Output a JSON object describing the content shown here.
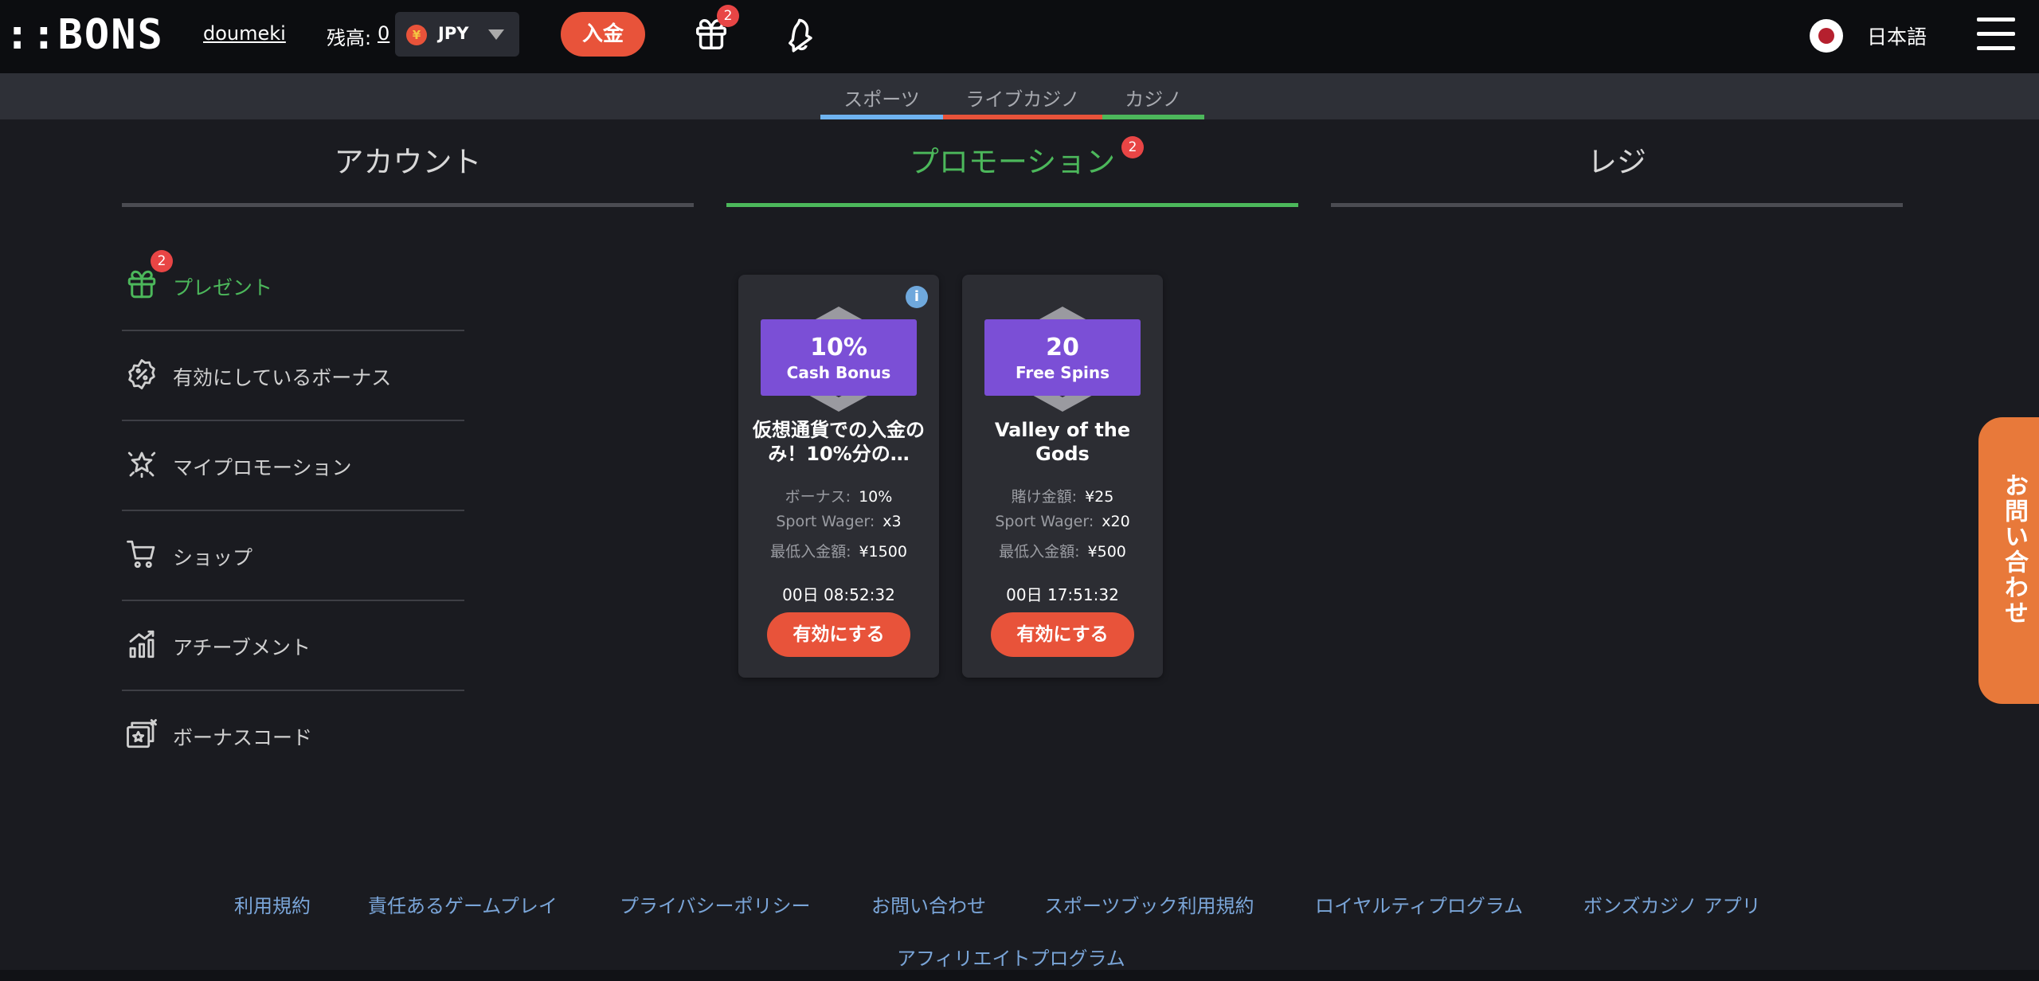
{
  "header": {
    "logo": "::BONS",
    "username": "doumeki",
    "balance_label": "残高:",
    "balance_value": "0",
    "currency_symbol": "¥",
    "currency_code": "JPY",
    "deposit_label": "入金",
    "gift_count": "2",
    "language": "日本語"
  },
  "categories": [
    "スポーツ",
    "ライブカジノ",
    "カジノ"
  ],
  "category_colors": [
    "#6fb3f0",
    "#e8533a",
    "#4cb85b"
  ],
  "main_tabs": [
    "アカウント",
    "プロモーション",
    "レジ"
  ],
  "promotion_badge": "2",
  "side_menu": {
    "badge": "2",
    "items": [
      "プレゼント",
      "有効にしているボーナス",
      "マイプロモーション",
      "ショップ",
      "アチーブメント",
      "ボーナスコード"
    ]
  },
  "cards": [
    {
      "big": "10%",
      "small": "Cash Bonus",
      "title": "仮想通貨での入金のみ！10%分の…",
      "rows": [
        {
          "k": "ボーナス:",
          "v": "10%"
        },
        {
          "k": "Sport Wager:",
          "v": "x3"
        },
        {
          "k": "最低入金額:",
          "v": "¥1500"
        }
      ],
      "timer": "00日  08:52:32",
      "button": "有効にする"
    },
    {
      "big": "20",
      "small": "Free Spins",
      "title": "Valley of the Gods",
      "rows": [
        {
          "k": "賭け金額:",
          "v": "¥25"
        },
        {
          "k": "Sport Wager:",
          "v": "x20"
        },
        {
          "k": "最低入金額:",
          "v": "¥500"
        }
      ],
      "timer": "00日  17:51:32",
      "button": "有効にする"
    }
  ],
  "contact_tab": "お問い合わせ",
  "footer_links": [
    "利用規約",
    "責任あるゲームプレイ",
    "プライバシーポリシー",
    "お問い合わせ",
    "スポーツブック利用規約",
    "ロイヤルティプログラム",
    "ボンズカジノ アプリ",
    "アフィリエイトプログラム"
  ],
  "colors": {
    "accent_green": "#4cb85b",
    "accent_orange": "#e8533a",
    "badge_red": "#e84545",
    "bonus_purple": "#7b4fd6"
  }
}
